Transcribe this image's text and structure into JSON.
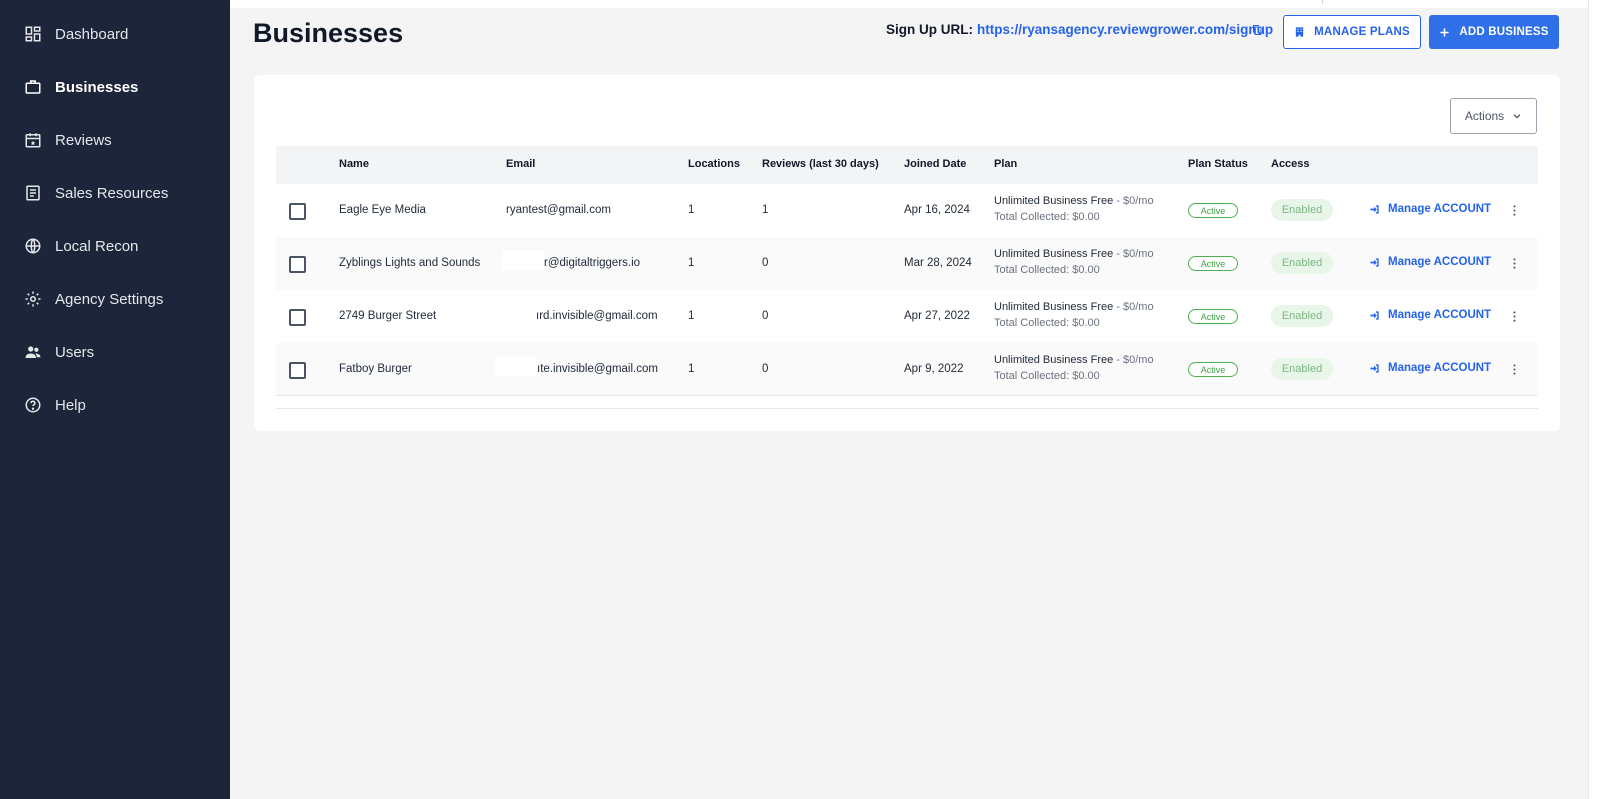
{
  "sidebar": {
    "items": [
      {
        "label": "Dashboard",
        "icon": "dashboard-icon"
      },
      {
        "label": "Businesses",
        "icon": "briefcase-icon",
        "active": true
      },
      {
        "label": "Reviews",
        "icon": "calendar-star-icon"
      },
      {
        "label": "Sales Resources",
        "icon": "document-list-icon"
      },
      {
        "label": "Local Recon",
        "icon": "globe-icon"
      },
      {
        "label": "Agency Settings",
        "icon": "gear-icon"
      },
      {
        "label": "Users",
        "icon": "users-icon"
      },
      {
        "label": "Help",
        "icon": "help-circle-icon"
      }
    ]
  },
  "header": {
    "title": "Businesses",
    "signup_label": "Sign Up URL:",
    "signup_url": "https://ryansagency.reviewgrower.com/signup",
    "manage_plans_label": "MANAGE PLANS",
    "add_business_label": "ADD BUSINESS"
  },
  "table": {
    "actions_label": "Actions",
    "columns": [
      "Name",
      "Email",
      "Locations",
      "Reviews (last 30 days)",
      "Joined Date",
      "Plan",
      "Plan Status",
      "Access"
    ],
    "rows": [
      {
        "name": "Eagle Eye Media",
        "email": "ryantest@gmail.com",
        "locations": "1",
        "reviews": "1",
        "joined": "Apr 16, 2024",
        "plan": "Unlimited Business Free",
        "price": " - $0/mo",
        "collected": "Total Collected: $0.00",
        "plan_status": "Active",
        "access": "Enabled",
        "manage": "Manage ACCOUNT"
      },
      {
        "name": "Zyblings Lights and Sounds",
        "email": "r@digitaltriggers.io",
        "locations": "1",
        "reviews": "0",
        "joined": "Mar 28, 2024",
        "plan": "Unlimited Business Free",
        "price": " - $0/mo",
        "collected": "Total Collected: $0.00",
        "plan_status": "Active",
        "access": "Enabled",
        "manage": "Manage ACCOUNT"
      },
      {
        "name": "2749 Burger Street",
        "email": "ırd.invisible@gmail.com",
        "locations": "1",
        "reviews": "0",
        "joined": "Apr 27, 2022",
        "plan": "Unlimited Business Free",
        "price": " - $0/mo",
        "collected": "Total Collected: $0.00",
        "plan_status": "Active",
        "access": "Enabled",
        "manage": "Manage ACCOUNT"
      },
      {
        "name": "Fatboy Burger",
        "email": "ıte.invisible@gmail.com",
        "locations": "1",
        "reviews": "0",
        "joined": "Apr 9, 2022",
        "plan": "Unlimited Business Free",
        "price": " - $0/mo",
        "collected": "Total Collected: $0.00",
        "plan_status": "Active",
        "access": "Enabled",
        "manage": "Manage ACCOUNT"
      }
    ]
  },
  "colors": {
    "sidebar_bg": "#1c253a",
    "accent": "#2f6fe8",
    "active_green": "#43a047"
  }
}
